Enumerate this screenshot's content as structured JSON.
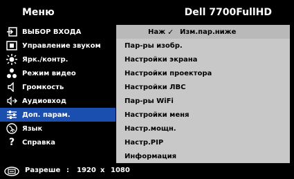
{
  "header": {
    "title": "Меню",
    "model": "Dell 7700FullHD"
  },
  "sidebar": {
    "items": [
      {
        "label": "ВЫБОР ВХОДА",
        "icon": "input-source-icon"
      },
      {
        "label": "Управление звуком",
        "icon": "sound-control-icon"
      },
      {
        "label": "Ярк./контр.",
        "icon": "brightness-icon"
      },
      {
        "label": "Режим видео",
        "icon": "video-mode-icon"
      },
      {
        "label": "Громкость",
        "icon": "volume-icon"
      },
      {
        "label": "Аудиовход",
        "icon": "audio-input-icon"
      },
      {
        "label": "Доп. парам.",
        "icon": "advanced-settings-icon",
        "active": true
      },
      {
        "label": "Язык",
        "icon": "language-icon"
      },
      {
        "label": "Справка",
        "icon": "help-icon"
      }
    ]
  },
  "content": {
    "first_row": {
      "left": "Наж",
      "check": "✓",
      "right": "Изм.пар.ниже"
    },
    "items": [
      "Пар-ры изобр.",
      "Настройки экрана",
      "Настройки проектора",
      "Настройки ЛВС",
      "Пар-ры WiFi",
      "Настройки меня",
      "Настр.мощн.",
      "Настр.PIP",
      "Информация"
    ]
  },
  "footer": {
    "label": "Разреше",
    "colon": ":",
    "width": "1920",
    "x": "x",
    "height": "1080",
    "icon": "resolution-icon"
  },
  "colors": {
    "active_bg": "#1a4fb0",
    "panel_bg": "#c8c8c8",
    "header_bg": "#000000"
  }
}
